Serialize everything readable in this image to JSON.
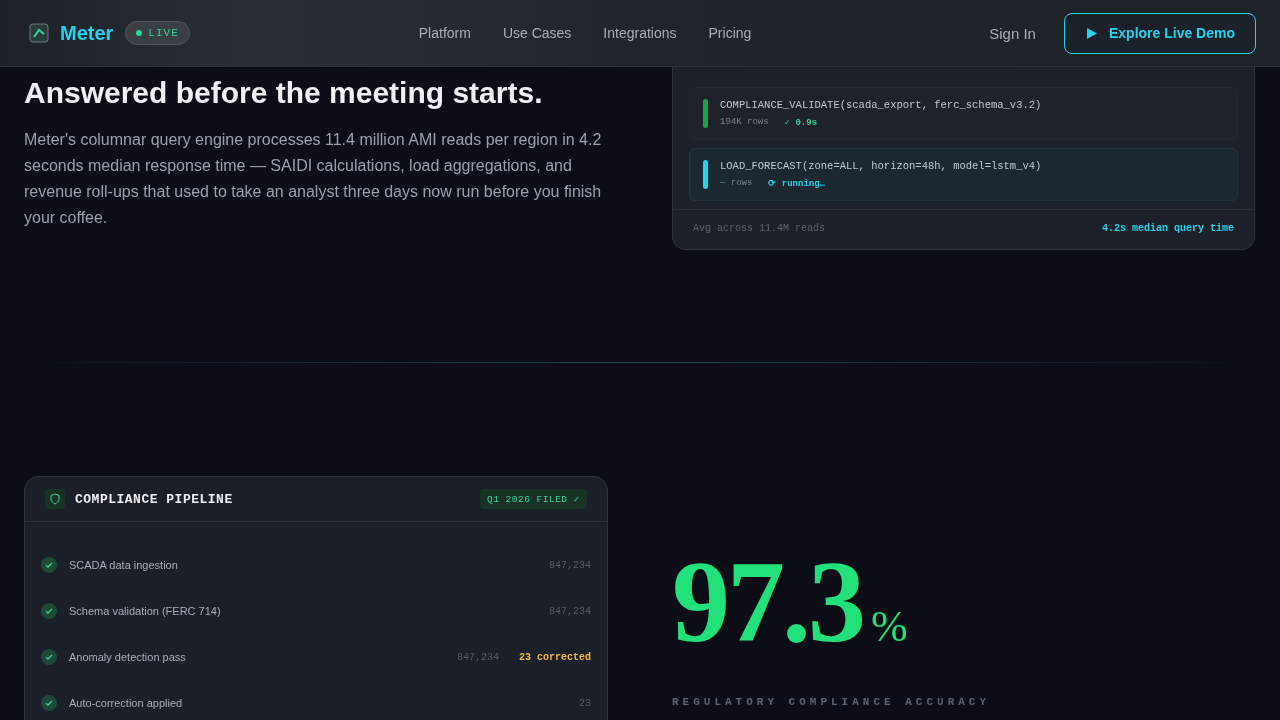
{
  "nav": {
    "brand": "Meter",
    "badge": "LIVE",
    "links": [
      "Platform",
      "Use Cases",
      "Integrations",
      "Pricing"
    ],
    "sign_in": "Sign In",
    "cta": "Explore Live Demo"
  },
  "hero": {
    "headline": "Answered before the meeting starts.",
    "body": "Meter's columnar query engine processes 11.4 million AMI reads per region in 4.2 seconds median response time — SAIDI calculations, load aggregations, and revenue roll-ups that used to take an analyst three days now run before you finish your coffee."
  },
  "query_card": {
    "queries": [
      {
        "query": "COMPLIANCE_VALIDATE(scada_export, ferc_schema_v3.2)",
        "rows": "194K rows",
        "kind": "done",
        "result": "✓ 0.9s"
      },
      {
        "query": "LOAD_FORECAST(zone=ALL, horizon=48h, model=lstm_v4)",
        "rows": "— rows",
        "kind": "running",
        "result": "⟳ running…"
      }
    ],
    "footer_left": "Avg across 11.4M reads",
    "footer_right": "4.2s median query time"
  },
  "pipeline": {
    "title": "COMPLIANCE PIPELINE",
    "badge": "Q1 2026 FILED ✓",
    "steps": [
      {
        "label": "SCADA data ingestion",
        "count": "847,234",
        "checked": true
      },
      {
        "label": "Schema validation (FERC 714)",
        "count": "847,234",
        "checked": true
      },
      {
        "label": "Anomaly detection pass",
        "count": "847,234",
        "note": "23 corrected",
        "checked": true
      },
      {
        "label": "Auto-correction applied",
        "count": "23",
        "checked": true
      }
    ]
  },
  "stat": {
    "value": "97.3",
    "unit": "%",
    "label": "REGULATORY COMPLIANCE ACCURACY"
  }
}
